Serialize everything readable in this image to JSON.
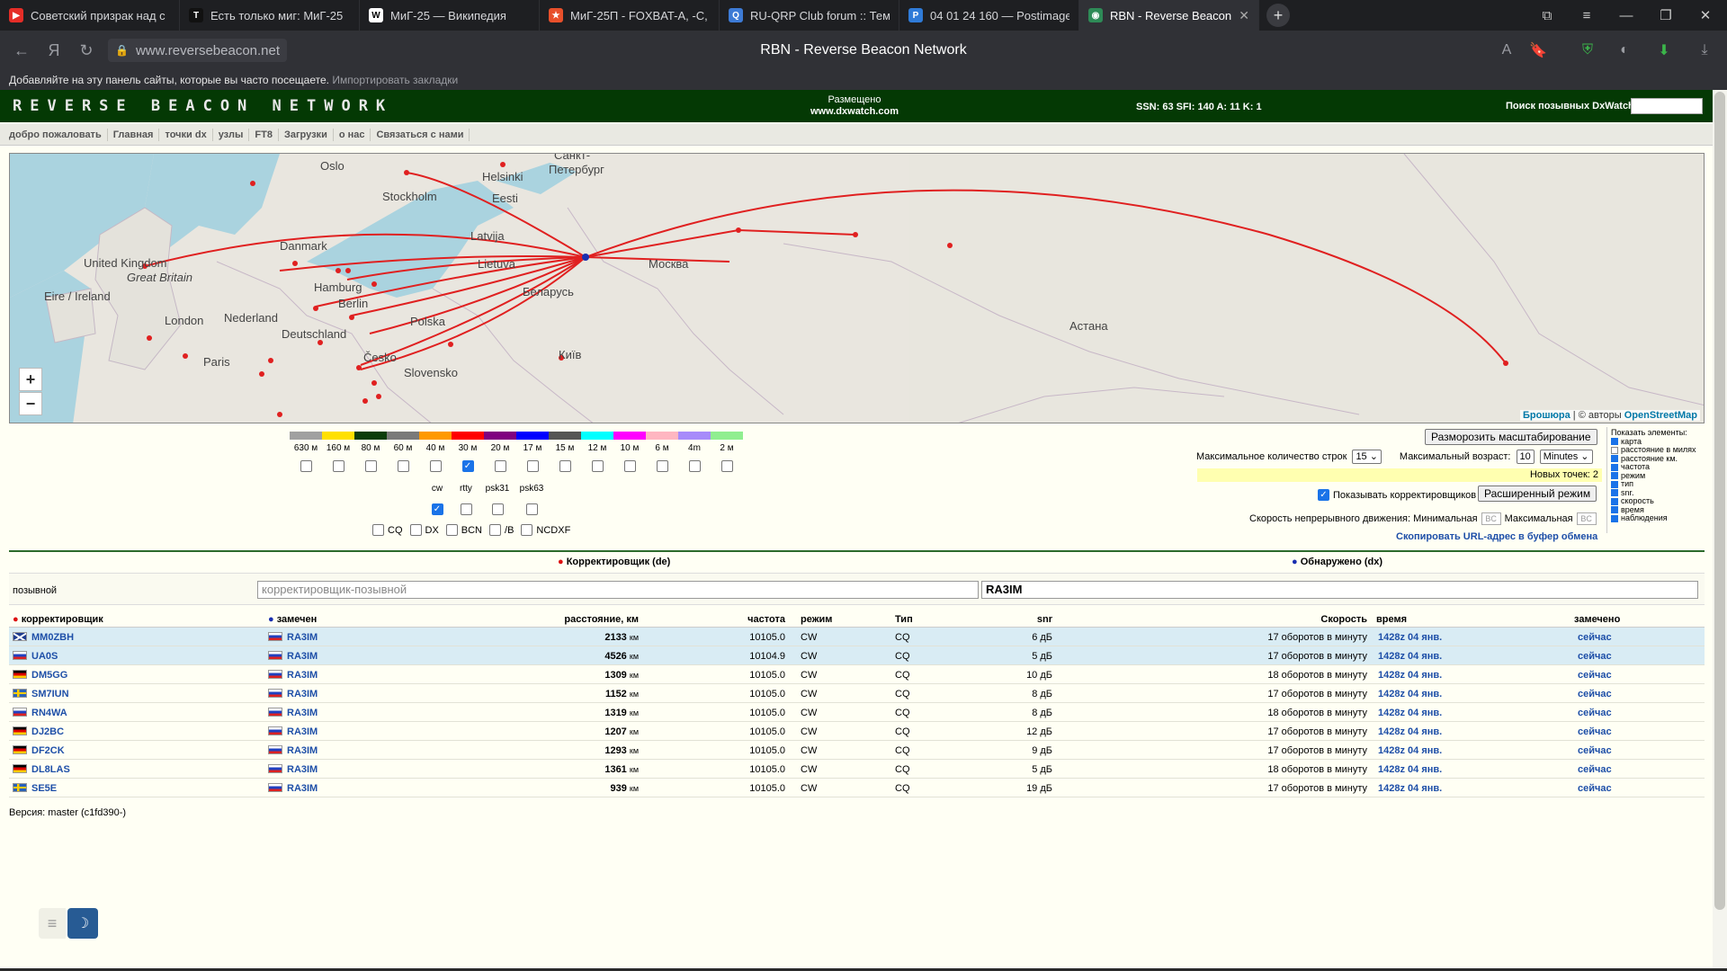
{
  "browser": {
    "tabs": [
      {
        "title": "Советский призрак над с",
        "icon": "youtube-icon",
        "color": "#e52d27",
        "glyph": "▶"
      },
      {
        "title": "Есть только миг: МиГ-25",
        "icon": "t-icon",
        "color": "#111111",
        "glyph": "T"
      },
      {
        "title": "МиГ-25 — Википедия",
        "icon": "wikipedia-icon",
        "color": "#ffffff",
        "glyph": "W"
      },
      {
        "title": "МиГ-25П - FOXBAT-A, -C,",
        "icon": "star-icon",
        "color": "#e8502b",
        "glyph": "★"
      },
      {
        "title": "RU-QRP Club forum :: Тема",
        "icon": "forum-icon",
        "color": "#3d7bd6",
        "glyph": "Q"
      },
      {
        "title": "04 01 24 160 — Postimage",
        "icon": "postimage-icon",
        "color": "#2f7bd8",
        "glyph": "P"
      },
      {
        "title": "RBN - Reverse Beacon N",
        "icon": "rbn-icon",
        "color": "#2e8b57",
        "glyph": "◉"
      }
    ],
    "url": "www.reversebeacon.net",
    "page_title": "RBN - Reverse Beacon Network",
    "bookmarks_text": "Добавляйте на эту панель сайты, которые вы часто посещаете.",
    "bookmarks_import": "Импортировать закладки"
  },
  "site": {
    "logo": "REVERSE BEACON NETWORK",
    "hosted_label": "Размещено",
    "hosted_site": "www.dxwatch.com",
    "solar": "SSN: 63 SFI: 140 A: 11 K: 1",
    "dx_search_label": "Поиск позывных DxWatch:",
    "nav": [
      "добро пожаловать",
      "Главная",
      "точки dx",
      "узлы",
      "FT8",
      "Загрузки",
      "о нас",
      "Связаться с нами"
    ]
  },
  "map": {
    "labels": [
      {
        "t": "Oslo"
      },
      {
        "t": "Helsinki"
      },
      {
        "t": "Санкт-"
      },
      {
        "t": "Петербург"
      },
      {
        "t": "Stockholm"
      },
      {
        "t": "Eesti"
      },
      {
        "t": "Latvija"
      },
      {
        "t": "Danmark"
      },
      {
        "t": "United Kingdom"
      },
      {
        "t": "Great Britain"
      },
      {
        "t": "Lietuva"
      },
      {
        "t": "Москва"
      },
      {
        "t": "Hamburg"
      },
      {
        "t": "Беларусь"
      },
      {
        "t": "Eire / Ireland"
      },
      {
        "t": "Berlin"
      },
      {
        "t": "London"
      },
      {
        "t": "Nederland"
      },
      {
        "t": "Polska"
      },
      {
        "t": "Deutschland"
      },
      {
        "t": "Астана"
      },
      {
        "t": "Київ"
      },
      {
        "t": "Paris"
      },
      {
        "t": "Česko"
      },
      {
        "t": "Slovensko"
      }
    ],
    "zoom_in": "+",
    "zoom_out": "−",
    "attrib_link": "Брошюра",
    "attrib_sep": " | © авторы ",
    "attrib_osm": "OpenStreetMap"
  },
  "bands": [
    {
      "label": "630 м",
      "color": "#a0a0a0",
      "checked": false
    },
    {
      "label": "160 м",
      "color": "#ffe000",
      "checked": false
    },
    {
      "label": "80 м",
      "color": "#0b3d0b",
      "checked": false
    },
    {
      "label": "60 м",
      "color": "#7a7a7a",
      "checked": false
    },
    {
      "label": "40 м",
      "color": "#ff9900",
      "checked": false
    },
    {
      "label": "30 м",
      "color": "#ff0000",
      "checked": true
    },
    {
      "label": "20 м",
      "color": "#800080",
      "checked": false
    },
    {
      "label": "17 м",
      "color": "#0000ff",
      "checked": false
    },
    {
      "label": "15 м",
      "color": "#555555",
      "checked": false
    },
    {
      "label": "12 м",
      "color": "#00ffff",
      "checked": false
    },
    {
      "label": "10 м",
      "color": "#ff00ff",
      "checked": false
    },
    {
      "label": "6 м",
      "color": "#ffb6c1",
      "checked": false
    },
    {
      "label": "4m",
      "color": "#a78bfa",
      "checked": false
    },
    {
      "label": "2 м",
      "color": "#90ee90",
      "checked": false
    }
  ],
  "modes": [
    {
      "label": "cw",
      "checked": true
    },
    {
      "label": "rtty",
      "checked": false
    },
    {
      "label": "psk31",
      "checked": false
    },
    {
      "label": "psk63",
      "checked": false
    }
  ],
  "filters": [
    "CQ",
    "DX",
    "BCN",
    "/B",
    "NCDXF"
  ],
  "controls": {
    "unfreeze": "Разморозить масштабирование",
    "max_rows_label": "Максимальное количество строк",
    "max_rows": "15",
    "max_age_label": "Максимальный возраст:",
    "max_age": "10",
    "max_age_unit": "Minutes",
    "new_points": "Новых точек: 2",
    "show_corr": "Показывать корректировщиков",
    "advanced": "Расширенный режим",
    "speed_label": "Скорость непрерывного движения: Минимальная",
    "speed_min": "BC",
    "speed_max_label": "Максимальная",
    "speed_max": "BC",
    "copy_url": "Скопировать URL-адрес в буфер обмена"
  },
  "show_elements": {
    "title": "Показать элементы:",
    "items": [
      "карта",
      "расстояние в милях",
      "расстояние км.",
      "частота",
      "режим",
      "тип",
      "snr.",
      "скорость",
      "время",
      "наблюдения"
    ],
    "checked": [
      true,
      false,
      true,
      true,
      true,
      true,
      true,
      true,
      true,
      true
    ]
  },
  "table": {
    "de_header": "Корректировщик (de)",
    "dx_header": "Обнаружено (dx)",
    "callsign_label": "позывной",
    "de_placeholder": "корректировщик-позывной",
    "dx_value": "RA3IM",
    "columns": {
      "de": "корректировщик",
      "dx": "замечен",
      "dist": "расстояние, км",
      "freq": "частота",
      "mode": "режим",
      "type": "Тип",
      "snr": "snr",
      "speed": "Скорость",
      "time": "время",
      "seen": "замечено"
    },
    "rows": [
      {
        "flag": "gb",
        "de": "MM0ZBH",
        "dx": "RA3IM",
        "dist": "2133",
        "freq": "10105.0",
        "mode": "CW",
        "type": "CQ",
        "snr": "6 дБ",
        "speed": "17 оборотов в минуту",
        "time": "1428z 04 янв.",
        "seen": "сейчас",
        "hl": true
      },
      {
        "flag": "ru",
        "de": "UA0S",
        "dx": "RA3IM",
        "dist": "4526",
        "freq": "10104.9",
        "mode": "CW",
        "type": "CQ",
        "snr": "5 дБ",
        "speed": "17 оборотов в минуту",
        "time": "1428z 04 янв.",
        "seen": "сейчас",
        "hl": true
      },
      {
        "flag": "de",
        "de": "DM5GG",
        "dx": "RA3IM",
        "dist": "1309",
        "freq": "10105.0",
        "mode": "CW",
        "type": "CQ",
        "snr": "10 дБ",
        "speed": "18 оборотов в минуту",
        "time": "1428z 04 янв.",
        "seen": "сейчас",
        "hl": false
      },
      {
        "flag": "se",
        "de": "SM7IUN",
        "dx": "RA3IM",
        "dist": "1152",
        "freq": "10105.0",
        "mode": "CW",
        "type": "CQ",
        "snr": "8 дБ",
        "speed": "17 оборотов в минуту",
        "time": "1428z 04 янв.",
        "seen": "сейчас",
        "hl": false
      },
      {
        "flag": "ru",
        "de": "RN4WA",
        "dx": "RA3IM",
        "dist": "1319",
        "freq": "10105.0",
        "mode": "CW",
        "type": "CQ",
        "snr": "8 дБ",
        "speed": "18 оборотов в минуту",
        "time": "1428z 04 янв.",
        "seen": "сейчас",
        "hl": false
      },
      {
        "flag": "de",
        "de": "DJ2BC",
        "dx": "RA3IM",
        "dist": "1207",
        "freq": "10105.0",
        "mode": "CW",
        "type": "CQ",
        "snr": "12 дБ",
        "speed": "17 оборотов в минуту",
        "time": "1428z 04 янв.",
        "seen": "сейчас",
        "hl": false
      },
      {
        "flag": "de",
        "de": "DF2CK",
        "dx": "RA3IM",
        "dist": "1293",
        "freq": "10105.0",
        "mode": "CW",
        "type": "CQ",
        "snr": "9 дБ",
        "speed": "17 оборотов в минуту",
        "time": "1428z 04 янв.",
        "seen": "сейчас",
        "hl": false
      },
      {
        "flag": "de",
        "de": "DL8LAS",
        "dx": "RA3IM",
        "dist": "1361",
        "freq": "10105.0",
        "mode": "CW",
        "type": "CQ",
        "snr": "5 дБ",
        "speed": "18 оборотов в минуту",
        "time": "1428z 04 янв.",
        "seen": "сейчас",
        "hl": false
      },
      {
        "flag": "se",
        "de": "SE5E",
        "dx": "RA3IM",
        "dist": "939",
        "freq": "10105.0",
        "mode": "CW",
        "type": "CQ",
        "snr": "19 дБ",
        "speed": "17 оборотов в минуту",
        "time": "1428z 04 янв.",
        "seen": "сейчас",
        "hl": false
      }
    ],
    "dist_unit": "км"
  },
  "version": "Версия: master (c1fd390-)"
}
